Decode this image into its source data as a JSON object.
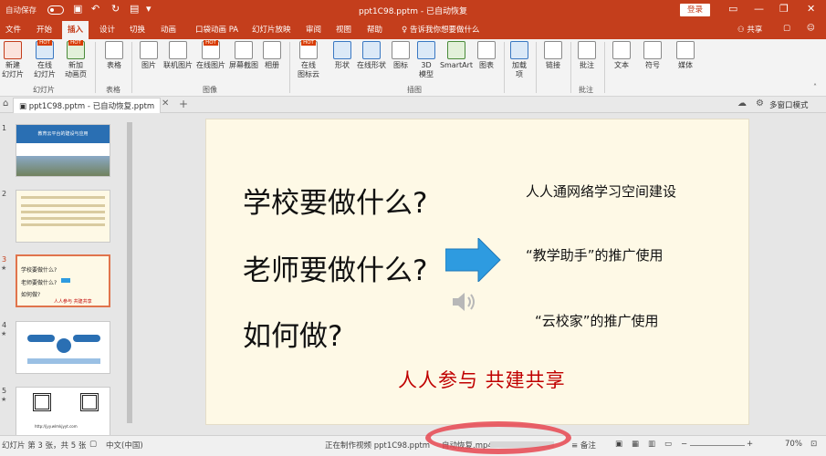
{
  "titlebar": {
    "autosave_label": "自动保存",
    "autosave_state": "关",
    "doc_title": "ppt1C98.pptm - 已自动恢复",
    "login_label": "登录"
  },
  "tabs": [
    "文件",
    "开始",
    "插入",
    "设计",
    "切换",
    "动画",
    "口袋动画 PA",
    "幻灯片放映",
    "审阅",
    "视图",
    "帮助"
  ],
  "active_tab_index": 2,
  "search_prompt": "告诉我你想要做什么",
  "share_label": "共享",
  "ribbon": {
    "buttons": [
      {
        "label": "新建\n幻灯片",
        "icon": "new-slide-icon"
      },
      {
        "label": "在线\n幻灯片",
        "icon": "online-slide-icon"
      },
      {
        "label": "新加\n动画页",
        "icon": "add-anim-page-icon"
      },
      {
        "label": "表格",
        "icon": "table-icon"
      },
      {
        "label": "图片",
        "icon": "picture-icon"
      },
      {
        "label": "联机图片",
        "icon": "online-picture-icon"
      },
      {
        "label": "在线图片",
        "icon": "web-picture-icon"
      },
      {
        "label": "屏幕截图",
        "icon": "screenshot-icon"
      },
      {
        "label": "相册",
        "icon": "album-icon"
      },
      {
        "label": "在线\n图标云",
        "icon": "icon-cloud-icon"
      },
      {
        "label": "形状",
        "icon": "shapes-icon"
      },
      {
        "label": "在线形状",
        "icon": "online-shapes-icon"
      },
      {
        "label": "图标",
        "icon": "icons-icon"
      },
      {
        "label": "3D\n模型",
        "icon": "3d-model-icon"
      },
      {
        "label": "SmartArt",
        "icon": "smartart-icon"
      },
      {
        "label": "图表",
        "icon": "chart-icon"
      },
      {
        "label": "加载\n项",
        "icon": "addins-icon"
      },
      {
        "label": "链接",
        "icon": "link-icon"
      },
      {
        "label": "批注",
        "icon": "comment-icon"
      },
      {
        "label": "文本",
        "icon": "text-icon"
      },
      {
        "label": "符号",
        "icon": "symbol-icon"
      },
      {
        "label": "媒体",
        "icon": "media-icon"
      }
    ],
    "hot_badge": "HOT",
    "groups": [
      "幻灯片",
      "表格",
      "图像",
      "插图",
      "批注"
    ]
  },
  "doc_tab": {
    "label": "ppt1C98.pptm - 已自动恢复.pptm",
    "multiwindow_label": "多窗口模式"
  },
  "thumbnails": {
    "numbers": [
      "1",
      "2",
      "3",
      "4",
      "5"
    ],
    "selected": 3,
    "thumb1_title": "教育云平台的建设与应用",
    "thumb5_caption": "http://jyy.wlmkjyyt.com"
  },
  "slide": {
    "questions": [
      "学校要做什么?",
      "老师要做什么?",
      "如何做?"
    ],
    "answers": [
      "人人通网络学习空间建设",
      "“教学助手”的推广使用",
      "“云校家”的推广使用"
    ],
    "motto": "人人参与  共建共享",
    "arrow_color": "#2e9be0",
    "motto_color": "#c00000"
  },
  "status": {
    "slide_info": "幻灯片 第 3 张，共 5 张",
    "language": "中文(中国)",
    "export_status": "正在制作视频 ppt1C98.pptm",
    "export_file": "自动恢复.mp4",
    "notes_label": "备注",
    "zoom": "70%",
    "progress_fraction": 0.0
  }
}
